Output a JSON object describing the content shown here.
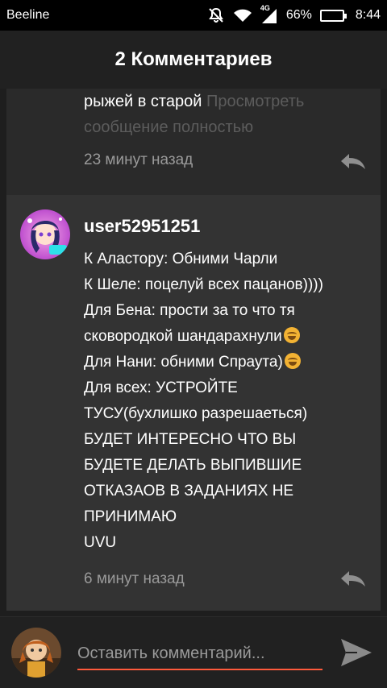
{
  "status_bar": {
    "carrier": "Beeline",
    "network_type": "4G",
    "battery_percent": "66%",
    "battery_level": 0.66,
    "time": "8:44",
    "icons": [
      "mute-icon",
      "wifi-icon",
      "signal-icon",
      "battery-icon"
    ]
  },
  "header": {
    "title": "2 Комментариев"
  },
  "comments": [
    {
      "text_visible": "рыжей в старой",
      "more_link": "Просмотреть сообщение полностью",
      "time": "23 минут назад"
    },
    {
      "username": "user52951251",
      "lines": [
        "К Аластору: Обними Чарли",
        "К Шеле: поцелуй всех пацанов))))",
        "Для Бена: прости за то что тя",
        "сковородкой шандарахнули",
        "Для Нани: обними Спраута)",
        "Для всех: УСТРОЙТЕ",
        "ТУСУ(бухлишко разрешаеться)",
        "БУДЕТ ИНТЕРЕСНО ЧТО ВЫ",
        "БУДЕТЕ ДЕЛАТЬ ВЫПИВШИЕ",
        "ОТКАЗАОВ В ЗАДАНИЯХ НЕ",
        "ПРИНИМАЮ",
        "UVU"
      ],
      "time": "6 минут назад"
    }
  ],
  "input": {
    "placeholder": "Оставить комментарий..."
  },
  "colors": {
    "accent": "#ff5a3c",
    "comment_bg": "#333333",
    "background": "#1e1e1e"
  }
}
